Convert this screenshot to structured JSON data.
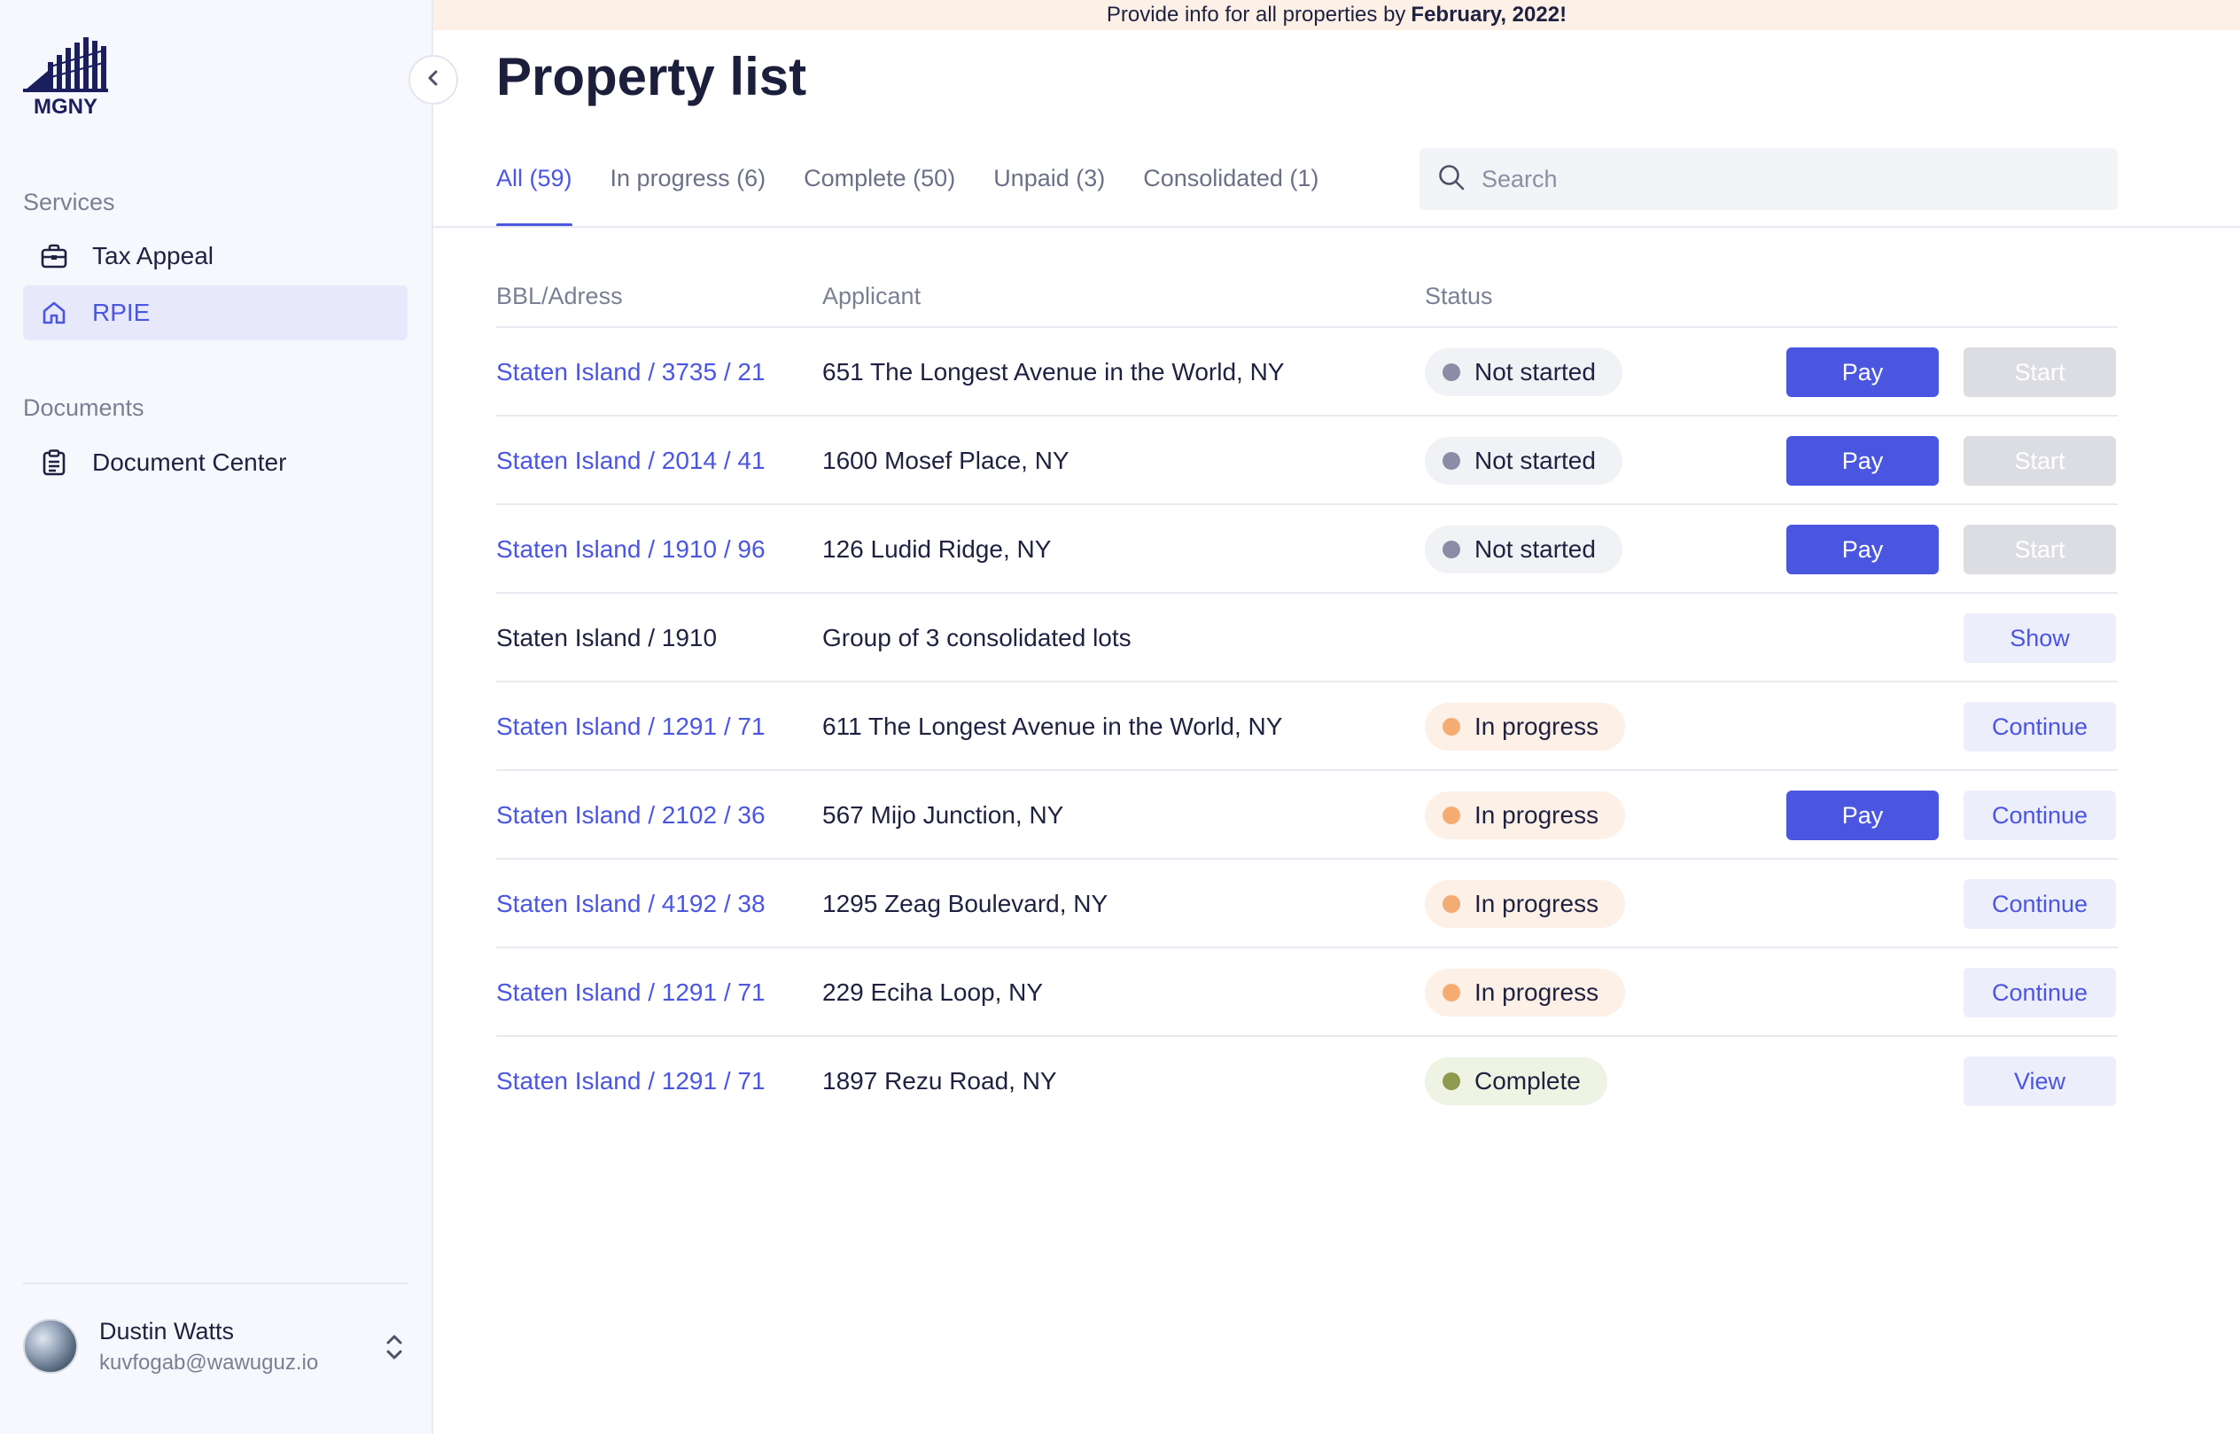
{
  "banner": {
    "text": "Provide info for all properties by",
    "deadline": "February, 2022!"
  },
  "brand": {
    "logo_text": "MGNY"
  },
  "sidebar": {
    "services_title": "Services",
    "documents_title": "Documents",
    "items": [
      {
        "label": "Tax Appeal",
        "icon": "briefcase-icon"
      },
      {
        "label": "RPIE",
        "icon": "home-icon",
        "active": true
      },
      {
        "label": "Document Center",
        "icon": "clipboard-icon"
      }
    ],
    "user": {
      "name": "Dustin Watts",
      "email": "kuvfogab@wawuguz.io"
    }
  },
  "main": {
    "title": "Property list",
    "tabs": [
      {
        "label": "All (59)",
        "active": true
      },
      {
        "label": "In progress (6)"
      },
      {
        "label": "Complete (50)"
      },
      {
        "label": "Unpaid (3)"
      },
      {
        "label": "Consolidated (1)"
      }
    ],
    "search": {
      "placeholder": "Search",
      "value": ""
    },
    "table": {
      "headers": {
        "bbl": "BBL/Adress",
        "applicant": "Applicant",
        "status": "Status"
      },
      "rows": [
        {
          "bbl": "Staten Island / 3735 / 21",
          "applicant": "651 The Longest Avenue in the World, NY",
          "status": "Not started",
          "pay": "Pay",
          "action": "Start"
        },
        {
          "bbl": "Staten Island / 2014 / 41",
          "applicant": "1600 Mosef Place, NY",
          "status": "Not started",
          "pay": "Pay",
          "action": "Start"
        },
        {
          "bbl": "Staten Island / 1910 / 96",
          "applicant": "126 Ludid Ridge, NY",
          "status": "Not started",
          "pay": "Pay",
          "action": "Start"
        },
        {
          "bbl": "Staten Island / 1910",
          "applicant": "Group of 3 consolidated lots",
          "action": "Show"
        },
        {
          "bbl": "Staten Island / 1291 / 71",
          "applicant": "611 The Longest Avenue in the World, NY",
          "status": "In progress",
          "action": "Continue"
        },
        {
          "bbl": "Staten Island / 2102 / 36",
          "applicant": "567 Mijo Junction, NY",
          "status": "In progress",
          "pay": "Pay",
          "action": "Continue"
        },
        {
          "bbl": "Staten Island / 4192 / 38",
          "applicant": "1295 Zeag Boulevard, NY",
          "status": "In progress",
          "action": "Continue"
        },
        {
          "bbl": "Staten Island / 1291 / 71",
          "applicant": "229 Eciha Loop, NY",
          "status": "In progress",
          "action": "Continue"
        },
        {
          "bbl": "Staten Island / 1291 / 71",
          "applicant": "1897 Rezu Road, NY",
          "status": "Complete",
          "action": "View"
        }
      ]
    }
  },
  "colors": {
    "accent": "#4b56e0",
    "sidebar_bg": "#f7f8fd",
    "banner_bg": "#fdf0e6",
    "status_not_started": "#8a8da5",
    "status_in_progress": "#f5ac73",
    "status_complete": "#8e9a4d"
  }
}
